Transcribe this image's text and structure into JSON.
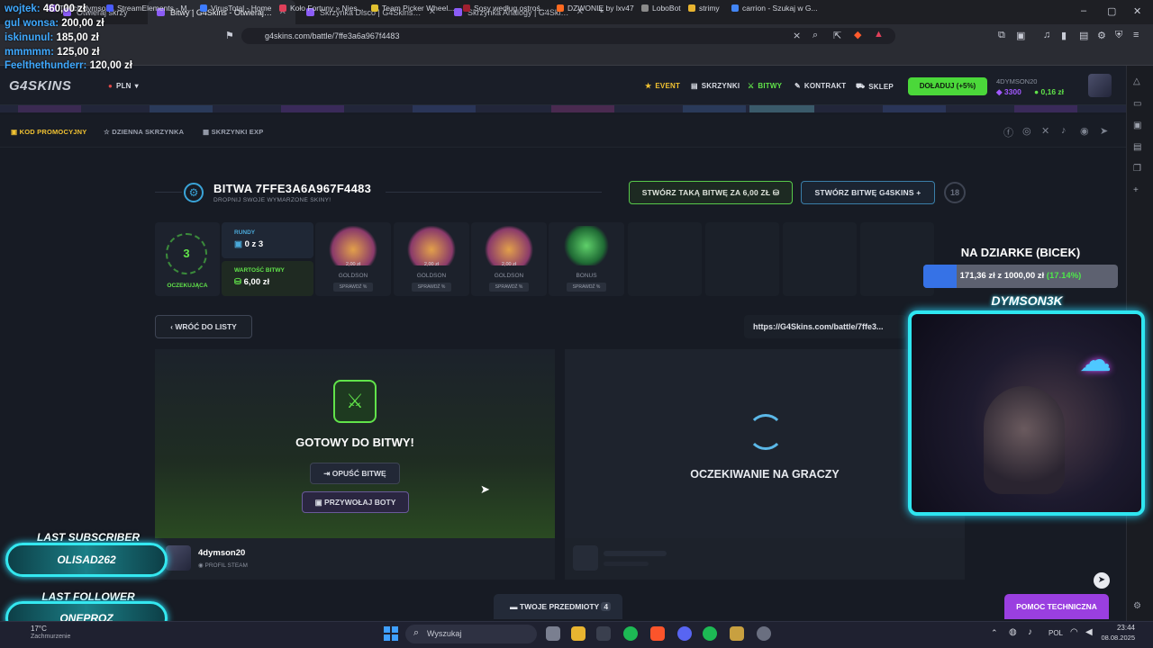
{
  "browser": {
    "tabs": [
      {
        "label": "Otwieraj skrzy"
      },
      {
        "label": "Bitwy | G4Skins - Otwieraj skrzynki"
      },
      {
        "label": "Skrzynka Disco | G4Skins - Otwieraj s"
      },
      {
        "label": "Skrzynka Analogy | G4Skins - Otwiera"
      }
    ],
    "url": "g4skins.com/battle/7ffe3a6a967f4483",
    "bookmarks": [
      "Twitch dymson",
      "StreamElements - M...",
      "VirusTotal - Home",
      "Koło Fortuny » Nies...",
      "Team Picker Wheel...",
      "Sosy według ostroś...",
      "DZWONIĘ by lxv47",
      "LoboBot",
      "strimy",
      "carrion - Szukaj w G..."
    ]
  },
  "donations": [
    {
      "name": "wojtek",
      "amount": "460,00 zł"
    },
    {
      "name": "gul wonsa",
      "amount": "200,00 zł"
    },
    {
      "name": "iskinunul",
      "amount": "185,00 zł"
    },
    {
      "name": "mmmmm",
      "amount": "125,00 zł"
    },
    {
      "name": "Feelthethunderr",
      "amount": "120,00 zł"
    }
  ],
  "site": {
    "logo": "G4SKINS",
    "currency": "PLN",
    "nav": [
      {
        "label": "EVENT",
        "icon": "star-icon"
      },
      {
        "label": "SKRZYNKI",
        "icon": "box-icon"
      },
      {
        "label": "BITWY",
        "icon": "swords-icon"
      },
      {
        "label": "KONTRAKT",
        "icon": "pen-icon"
      },
      {
        "label": "SKLEP",
        "icon": "cart-icon"
      }
    ],
    "deposit_label": "DOŁADUJ (+5%)",
    "user": {
      "name": "4DYMSON20",
      "points": "3300",
      "balance": "0,16 zł"
    },
    "subnav": [
      "KOD PROMOCYJNY",
      "DZIENNA SKRZYNKA",
      "SKRZYNKI EXP"
    ]
  },
  "battle": {
    "title": "BITWA 7FFE3A6A967F4483",
    "subtitle": "DROPNIJ SWOJE WYMARZONE SKINY!",
    "create_same_label": "STWÓRZ TAKĄ BITWĘ ZA 6,00 ZŁ",
    "create_g4_label": "STWÓRZ BITWĘ G4SKINS",
    "age_badge": "18",
    "waiting_count": "3",
    "waiting_label": "OCZEKUJĄCA",
    "rounds_label": "RUNDY",
    "rounds_value": "0 z 3",
    "value_label": "WARTOŚĆ BITWY",
    "value_value": "6,00 zł",
    "cases": [
      {
        "name": "GOLDSON",
        "price": "2,00 zł",
        "check": "SPRAWDŹ %",
        "color": "#c46f3a"
      },
      {
        "name": "GOLDSON",
        "price": "2,00 zł",
        "check": "SPRAWDŹ %",
        "color": "#c46f3a"
      },
      {
        "name": "GOLDSON",
        "price": "2,00 zł",
        "check": "SPRAWDŹ %",
        "color": "#c46f3a"
      },
      {
        "name": "BONUS",
        "price": "",
        "check": "SPRAWDŹ %",
        "color": "#3aa04a"
      }
    ],
    "back_label": "WRÓĆ DO LISTY",
    "share_url": "https://G4Skins.com/battle/7ffe3...",
    "ready_label": "GOTOWY DO BITWY!",
    "leave_label": "OPUŚĆ BITWĘ",
    "bots_label": "PRZYWOŁAJ BOTY",
    "waiting_players": "OCZEKIWANIE NA GRACZY",
    "player_name": "4dymson20",
    "player_profile": "PROFIL STEAM",
    "items_label": "TWOJE PRZEDMIOTY",
    "items_count": "4",
    "support_label": "POMOC TECHNICZNA"
  },
  "stream": {
    "goal_title": "NA DZIARKE (BICEK)",
    "goal_current": "171,36 zł",
    "goal_sep": "z",
    "goal_target": "1000,00 zł",
    "goal_pct": "(17.14%)",
    "goal_fraction": 0.1714,
    "cam_name": "DYMSON3K",
    "last_sub_label": "LAST SUBSCRIBER",
    "last_sub": "OLISAD262",
    "last_follow_label": "LAST FOLLOWER",
    "last_follow": "ONEPROZ"
  },
  "taskbar": {
    "search_placeholder": "Wyszukaj",
    "weather": "17°C",
    "weather_sub": "Zachmurzenie",
    "lang": "POL",
    "time": "23:44",
    "date": "08.08.2025"
  }
}
